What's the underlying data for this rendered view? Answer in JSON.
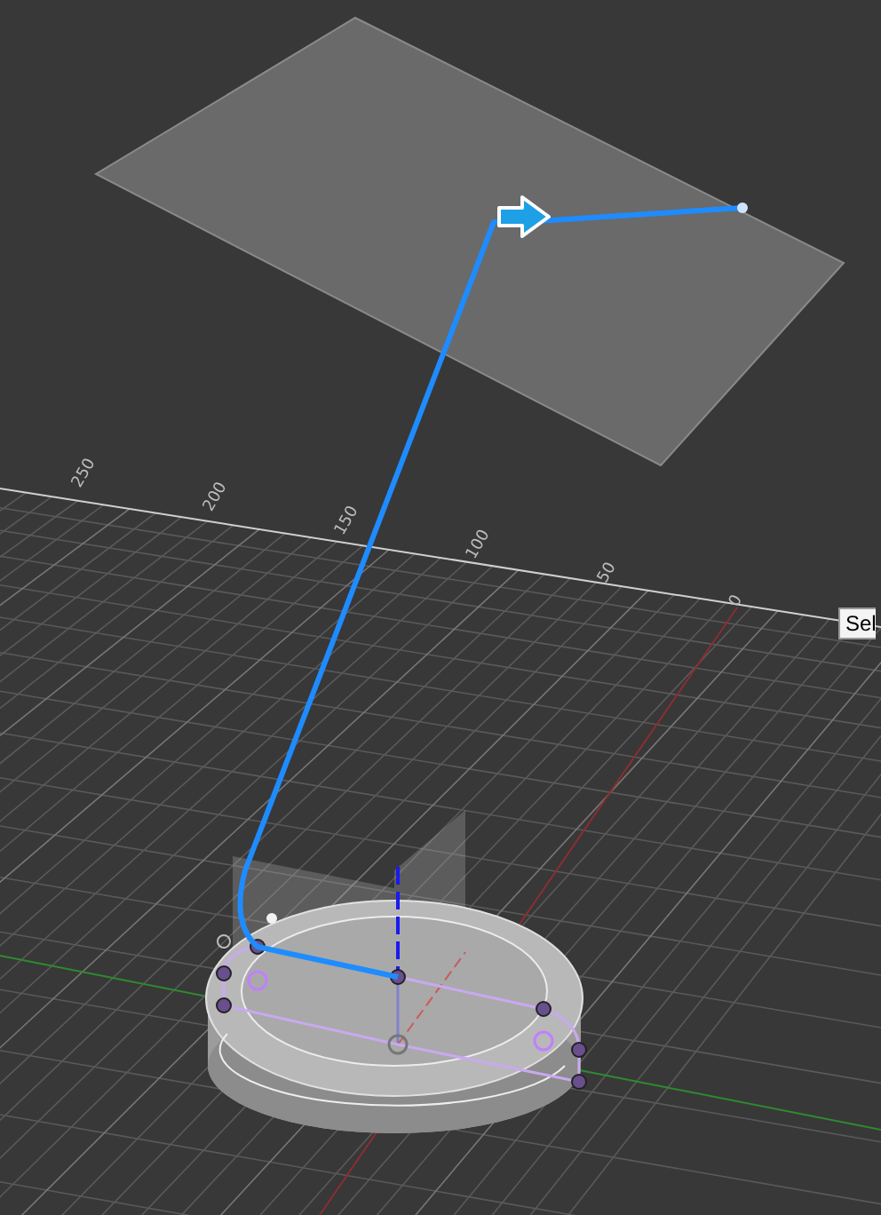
{
  "ruler": {
    "labels": [
      "250",
      "200",
      "150",
      "100",
      "50",
      "0"
    ]
  },
  "tooltip": {
    "text": "Sel"
  }
}
